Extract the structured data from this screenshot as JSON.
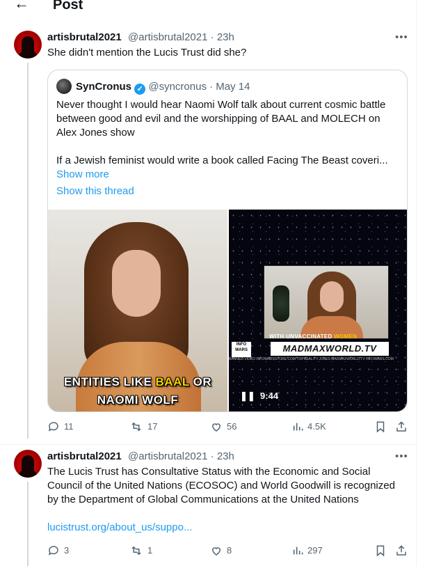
{
  "header": {
    "back_icon": "arrow-left-icon",
    "title": "Post"
  },
  "reply1": {
    "name": "artisbrutal2021",
    "handle": "@artisbrutal2021",
    "time": "23h",
    "text": "She didn't mention the Lucis Trust did she?",
    "quote": {
      "name": "SynCronus",
      "verified_icon": "verified-badge-icon",
      "handle": "@syncronus",
      "date": "May 14",
      "text_1": "Never thought I would hear Naomi Wolf talk about current cosmic battle between good and evil and the worshipping of BAAL and MOLECH on Alex Jones show",
      "text_2": "If a Jewish feminist would write a book called Facing The Beast coveri...",
      "show_more": "Show more",
      "show_thread": "Show this thread",
      "media_left": {
        "caption_pre": "ENTITIES LIKE ",
        "caption_hl": "BAAL",
        "caption_post": " OR",
        "caption_line2": "NAOMI WOLF"
      },
      "media_right": {
        "banner_pre": "WITH UNVACCINATED ",
        "banner_hl": "WOMEN",
        "logo": "MADMAXWORLD.TV",
        "infowars": "INFO WARS",
        "ticker": "BANNED.VIDEO    INFOWARSSTORE.COM    TOPREALITY.JONES    MADMAXWORLD.TV    INFOWARS.COM",
        "duration": "9:44",
        "pause_icon": "pause-icon"
      }
    },
    "stats": {
      "replies": "11",
      "reposts": "17",
      "likes": "56",
      "views": "4.5K"
    }
  },
  "reply2": {
    "name": "artisbrutal2021",
    "handle": "@artisbrutal2021",
    "time": "23h",
    "text": "The Lucis Trust has Consultative Status with the Economic and Social Council of the United Nations (ECOSOC)  and  World Goodwill is recognized by the Department of Global Communications at the United Nations",
    "link": "lucistrust.org/about_us/suppo...",
    "stats": {
      "replies": "3",
      "reposts": "1",
      "likes": "8",
      "views": "297"
    }
  },
  "ui": {
    "dot_sep": "·",
    "more_icon": "more-horizontal-icon"
  },
  "colors": {
    "accent": "#1d9bf0",
    "muted": "#536471",
    "text": "#0f1419",
    "border": "#cfd9de"
  }
}
